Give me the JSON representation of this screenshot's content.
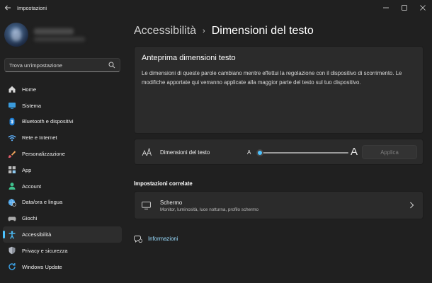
{
  "window": {
    "title": "Impostazioni",
    "back_icon": "back-arrow-icon",
    "controls": [
      "minimize-icon",
      "maximize-icon",
      "close-icon"
    ]
  },
  "sidebar": {
    "search_placeholder": "Trova un'impostazione",
    "search_icon": "search-icon",
    "items": [
      {
        "label": "Home",
        "icon": "home-icon"
      },
      {
        "label": "Sistema",
        "icon": "system-icon"
      },
      {
        "label": "Bluetooth e dispositivi",
        "icon": "bluetooth-icon"
      },
      {
        "label": "Rete e Internet",
        "icon": "wifi-icon"
      },
      {
        "label": "Personalizzazione",
        "icon": "brush-icon"
      },
      {
        "label": "App",
        "icon": "apps-icon"
      },
      {
        "label": "Account",
        "icon": "account-icon"
      },
      {
        "label": "Data/ora e lingua",
        "icon": "globe-clock-icon"
      },
      {
        "label": "Giochi",
        "icon": "gamepad-icon"
      },
      {
        "label": "Accessibilità",
        "icon": "accessibility-icon",
        "active": true
      },
      {
        "label": "Privacy e sicurezza",
        "icon": "shield-icon"
      },
      {
        "label": "Windows Update",
        "icon": "update-icon"
      }
    ]
  },
  "breadcrumb": {
    "parent": "Accessibilità",
    "separator": "›",
    "current": "Dimensioni del testo"
  },
  "preview": {
    "title": "Anteprima dimensioni testo",
    "text": "Le dimensioni di queste parole cambiano mentre effettui la regolazione con il dispositivo di scorrimento. Le modifiche apportate qui verranno applicate alla maggior parte del testo sul tuo dispositivo."
  },
  "text_size": {
    "label": "Dimensioni del testo",
    "icon": "text-size-icon",
    "small_label": "A",
    "large_label": "A",
    "slider_value_fraction": 0.0,
    "apply_label": "Applica"
  },
  "related": {
    "title": "Impostazioni correlate",
    "screen": {
      "title": "Schermo",
      "subtitle": "Monitor, luminosità, luce notturna, profilo schermo",
      "icon": "monitor-icon"
    }
  },
  "info": {
    "label": "Informazioni",
    "icon": "info-icon"
  },
  "colors": {
    "background": "#202020",
    "card": "#2b2b2b",
    "accent": "#4cc2ff",
    "link": "#99dcff"
  }
}
